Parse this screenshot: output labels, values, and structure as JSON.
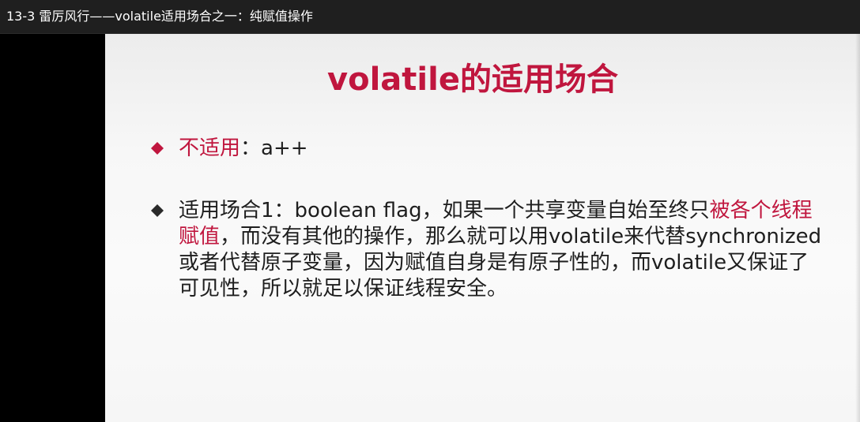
{
  "window": {
    "title": "13-3 雷厉风行——volatile适用场合之一：纯赋值操作"
  },
  "slide": {
    "title": "volatile的适用场合",
    "bullets": [
      {
        "highlight": "不适用",
        "rest": "：a++"
      },
      {
        "prefix": "适用场合1：boolean flag，如果一个共享变量自始至终只",
        "highlight": "被各个线程赋值",
        "rest": "，而没有其他的操作，那么就可以用volatile来代替synchronized或者代替原子变量，因为赋值自身是有原子性的，而volatile又保证了可见性，所以就足以保证线程安全。"
      }
    ]
  },
  "colors": {
    "accent": "#c0163e",
    "text": "#1e1e1e",
    "bullet_dark": "#2a2a2a",
    "titlebar": "#1f1f1f"
  },
  "icons": {
    "bullet1": "diamond-icon",
    "bullet2": "diamond-icon"
  }
}
